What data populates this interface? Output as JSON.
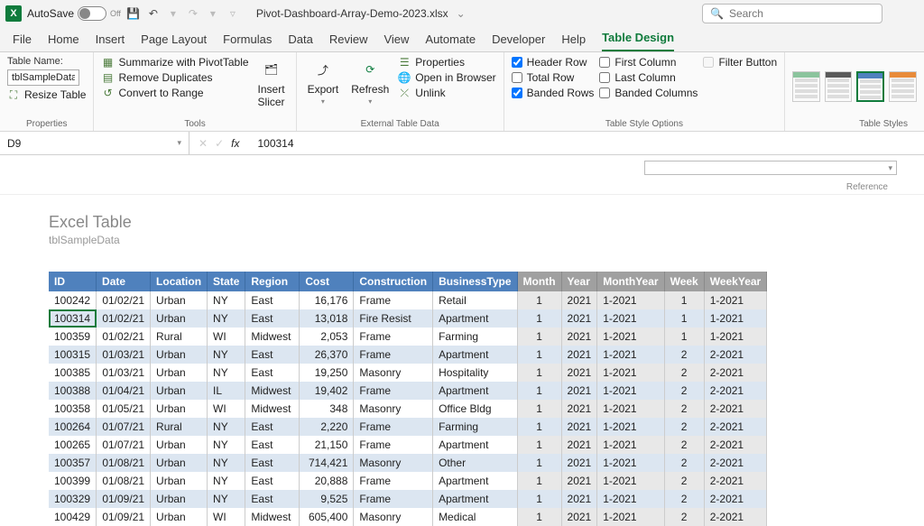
{
  "titlebar": {
    "autosave": "AutoSave",
    "autosave_state": "Off",
    "filename": "Pivot-Dashboard-Array-Demo-2023.xlsx",
    "search_placeholder": "Search"
  },
  "tabs": [
    "File",
    "Home",
    "Insert",
    "Page Layout",
    "Formulas",
    "Data",
    "Review",
    "View",
    "Automate",
    "Developer",
    "Help",
    "Table Design"
  ],
  "active_tab": "Table Design",
  "ribbon": {
    "properties": {
      "label": "Properties",
      "table_name_label": "Table Name:",
      "table_name": "tblSampleData",
      "resize": "Resize Table"
    },
    "tools": {
      "label": "Tools",
      "summarize": "Summarize with PivotTable",
      "remove_dup": "Remove Duplicates",
      "convert": "Convert to Range",
      "slicer": "Insert\nSlicer"
    },
    "export": {
      "label": "External Table Data",
      "export": "Export",
      "refresh": "Refresh",
      "props": "Properties",
      "open": "Open in Browser",
      "unlink": "Unlink"
    },
    "style_opts": {
      "label": "Table Style Options",
      "header": "Header Row",
      "total": "Total Row",
      "banded_r": "Banded Rows",
      "first": "First Column",
      "last": "Last Column",
      "banded_c": "Banded Columns",
      "filter": "Filter Button"
    },
    "styles": {
      "label": "Table Styles"
    }
  },
  "formula_bar": {
    "cell": "D9",
    "value": "100314",
    "fx": "fx"
  },
  "reference": "Reference",
  "sheet": {
    "title": "Excel Table",
    "subtitle": "tblSampleData"
  },
  "columns": [
    "ID",
    "Date",
    "Location",
    "State",
    "Region",
    "Cost",
    "Construction",
    "BusinessType",
    "Month",
    "Year",
    "MonthYear",
    "Week",
    "WeekYear"
  ],
  "rows": [
    [
      "100242",
      "01/02/21",
      "Urban",
      "NY",
      "East",
      "16,176",
      "Frame",
      "Retail",
      "1",
      "2021",
      "1-2021",
      "1",
      "1-2021"
    ],
    [
      "100314",
      "01/02/21",
      "Urban",
      "NY",
      "East",
      "13,018",
      "Fire Resist",
      "Apartment",
      "1",
      "2021",
      "1-2021",
      "1",
      "1-2021"
    ],
    [
      "100359",
      "01/02/21",
      "Rural",
      "WI",
      "Midwest",
      "2,053",
      "Frame",
      "Farming",
      "1",
      "2021",
      "1-2021",
      "1",
      "1-2021"
    ],
    [
      "100315",
      "01/03/21",
      "Urban",
      "NY",
      "East",
      "26,370",
      "Frame",
      "Apartment",
      "1",
      "2021",
      "1-2021",
      "2",
      "2-2021"
    ],
    [
      "100385",
      "01/03/21",
      "Urban",
      "NY",
      "East",
      "19,250",
      "Masonry",
      "Hospitality",
      "1",
      "2021",
      "1-2021",
      "2",
      "2-2021"
    ],
    [
      "100388",
      "01/04/21",
      "Urban",
      "IL",
      "Midwest",
      "19,402",
      "Frame",
      "Apartment",
      "1",
      "2021",
      "1-2021",
      "2",
      "2-2021"
    ],
    [
      "100358",
      "01/05/21",
      "Urban",
      "WI",
      "Midwest",
      "348",
      "Masonry",
      "Office Bldg",
      "1",
      "2021",
      "1-2021",
      "2",
      "2-2021"
    ],
    [
      "100264",
      "01/07/21",
      "Rural",
      "NY",
      "East",
      "2,220",
      "Frame",
      "Farming",
      "1",
      "2021",
      "1-2021",
      "2",
      "2-2021"
    ],
    [
      "100265",
      "01/07/21",
      "Urban",
      "NY",
      "East",
      "21,150",
      "Frame",
      "Apartment",
      "1",
      "2021",
      "1-2021",
      "2",
      "2-2021"
    ],
    [
      "100357",
      "01/08/21",
      "Urban",
      "NY",
      "East",
      "714,421",
      "Masonry",
      "Other",
      "1",
      "2021",
      "1-2021",
      "2",
      "2-2021"
    ],
    [
      "100399",
      "01/08/21",
      "Urban",
      "NY",
      "East",
      "20,888",
      "Frame",
      "Apartment",
      "1",
      "2021",
      "1-2021",
      "2",
      "2-2021"
    ],
    [
      "100329",
      "01/09/21",
      "Urban",
      "NY",
      "East",
      "9,525",
      "Frame",
      "Apartment",
      "1",
      "2021",
      "1-2021",
      "2",
      "2-2021"
    ],
    [
      "100429",
      "01/09/21",
      "Urban",
      "WI",
      "Midwest",
      "605,400",
      "Masonry",
      "Medical",
      "1",
      "2021",
      "1-2021",
      "2",
      "2-2021"
    ]
  ],
  "selected_row": 1
}
